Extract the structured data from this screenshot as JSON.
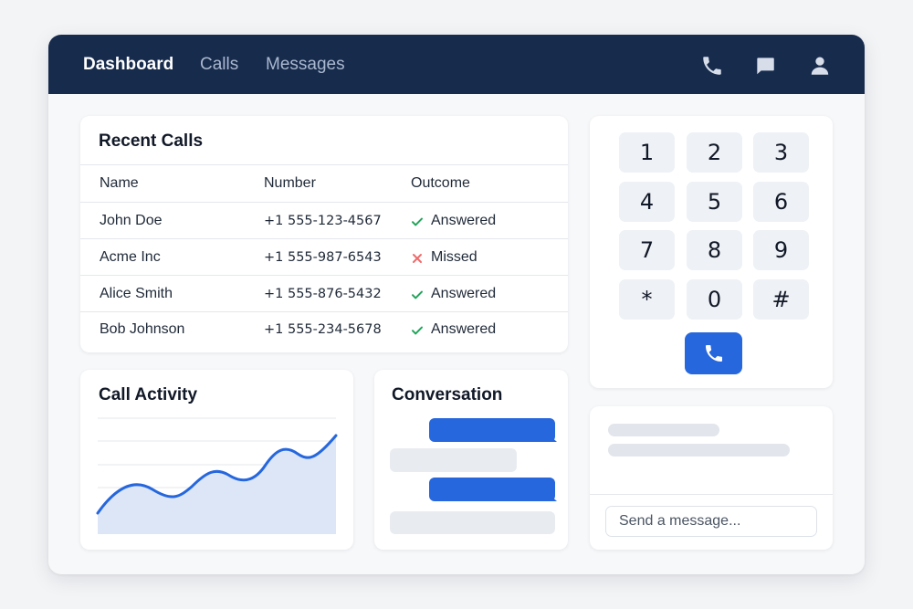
{
  "nav": {
    "items": [
      {
        "label": "Dashboard",
        "active": true
      },
      {
        "label": "Calls",
        "active": false
      },
      {
        "label": "Messages",
        "active": false
      }
    ],
    "icons": [
      "phone-icon",
      "chat-icon",
      "user-icon"
    ]
  },
  "recent_calls": {
    "title": "Recent Calls",
    "columns": [
      "Name",
      "Number",
      "Outcome"
    ],
    "rows": [
      {
        "name": "John Doe",
        "number": "+1 555-123-4567",
        "outcome": "Answered",
        "status": "answered"
      },
      {
        "name": "Acme Inc",
        "number": "+1 555-987-6543",
        "outcome": "Missed",
        "status": "missed"
      },
      {
        "name": "Alice Smith",
        "number": "+1 555-876-5432",
        "outcome": "Answered",
        "status": "answered"
      },
      {
        "name": "Bob Johnson",
        "number": "+1 555-234-5678",
        "outcome": "Answered",
        "status": "answered"
      }
    ]
  },
  "dialpad": {
    "keys": [
      "1",
      "2",
      "3",
      "4",
      "5",
      "6",
      "7",
      "8",
      "9",
      "*",
      "0",
      "#"
    ],
    "call_icon": "phone-icon"
  },
  "call_activity": {
    "title": "Call Activity"
  },
  "conversation": {
    "title": "Conversation"
  },
  "message_panel": {
    "placeholder": "Send a message..."
  },
  "colors": {
    "nav_bg": "#172b4d",
    "accent": "#2667dd",
    "answered": "#22a45a",
    "missed": "#ef6b6b",
    "chart_fill": "#dce6f7"
  }
}
